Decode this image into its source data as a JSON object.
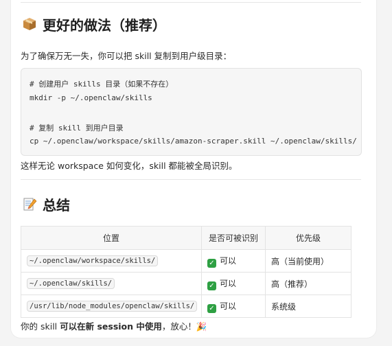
{
  "section1": {
    "title": "更好的做法（推荐）",
    "intro": "为了确保万无一失，你可以把 skill 复制到用户级目录：",
    "code": [
      "# 创建用户 skills 目录（如果不存在）",
      "mkdir -p ~/.openclaw/skills",
      "",
      "# 复制 skill 到用户目录",
      "cp ~/.openclaw/workspace/skills/amazon-scraper.skill ~/.openclaw/skills/"
    ],
    "after": "这样无论 workspace 如何变化，skill 都能被全局识别。"
  },
  "section2": {
    "title": "总结",
    "table": {
      "headers": [
        "位置",
        "是否可被识别",
        "优先级"
      ],
      "rows": [
        {
          "path": "~/.openclaw/workspace/skills/",
          "recognized": "可以",
          "priority": "高（当前使用）"
        },
        {
          "path": "~/.openclaw/skills/",
          "recognized": "可以",
          "priority": "高（推荐）"
        },
        {
          "path": "/usr/lib/node_modules/openclaw/skills/",
          "recognized": "可以",
          "priority": "系统级"
        }
      ]
    },
    "final_pre": "你的 skill ",
    "final_bold": "可以在新 session 中使用",
    "final_post": "，放心！🎉"
  }
}
